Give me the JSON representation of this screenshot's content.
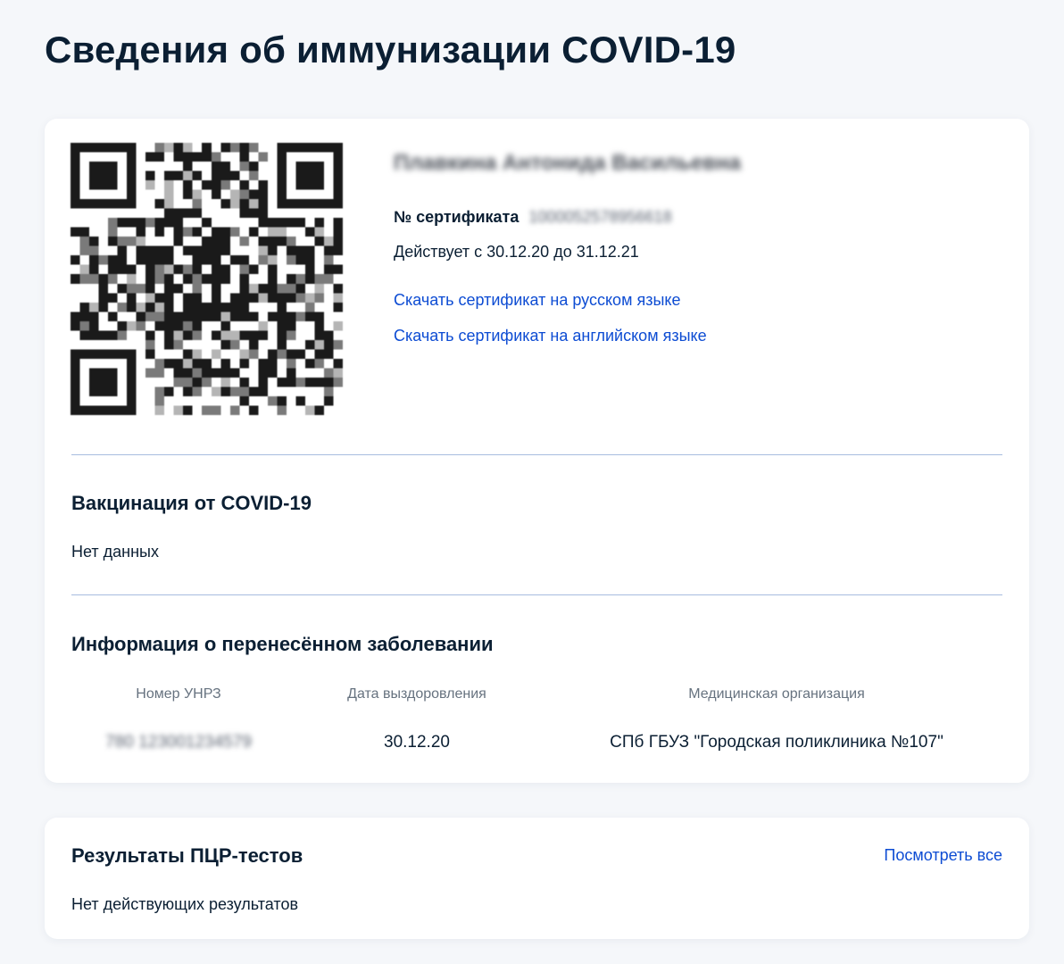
{
  "page": {
    "title": "Сведения об иммунизации COVID-19"
  },
  "certificate": {
    "holder_name": "Плавкина Антонида Васильевна",
    "number_label": "№ сертификата",
    "number_value": "1000052578956618",
    "validity": "Действует с 30.12.20 до 31.12.21",
    "link_ru": "Скачать сертификат на русском языке",
    "link_en": "Скачать сертификат на английском языке"
  },
  "vaccination": {
    "title": "Вакцинация от COVID-19",
    "text": "Нет данных"
  },
  "disease": {
    "title": "Информация о перенесённом заболевании",
    "columns": [
      "Номер УНРЗ",
      "Дата выздоровления",
      "Медицинская организация"
    ],
    "row": {
      "unrz": "780 123001234579",
      "recovery_date": "30.12.20",
      "organization": "СПб ГБУЗ \"Городская поликлиника №107\""
    }
  },
  "pcr": {
    "title": "Результаты ПЦР-тестов",
    "view_all": "Посмотреть все",
    "text": "Нет действующих результатов"
  },
  "colors": {
    "background": "#f5f7fa",
    "card": "#ffffff",
    "text": "#0b1f33",
    "link": "#0d4cd3",
    "divider": "#a7bcdf",
    "muted": "#66727f"
  }
}
